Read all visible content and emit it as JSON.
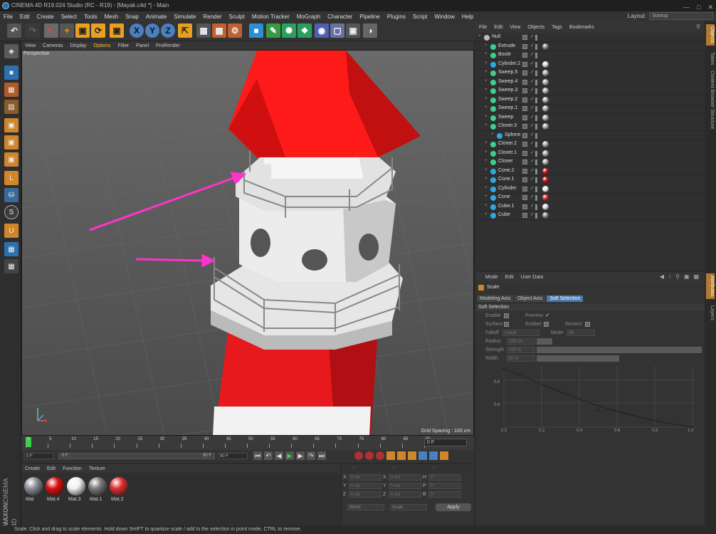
{
  "window": {
    "title": "CINEMA 4D R19.024 Studio (RC - R19) - [Mayak.c4d *] - Main"
  },
  "menu": [
    "File",
    "Edit",
    "Create",
    "Select",
    "Tools",
    "Mesh",
    "Snap",
    "Animate",
    "Simulate",
    "Render",
    "Sculpt",
    "Motion Tracker",
    "MoGraph",
    "Character",
    "Pipeline",
    "Plugins",
    "Script",
    "Window",
    "Help"
  ],
  "layout": {
    "label": "Layout:",
    "value": "Startup"
  },
  "viewport": {
    "menu": [
      "View",
      "Cameras",
      "Display",
      "Options",
      "Filter",
      "Panel",
      "ProRender"
    ],
    "camera": "Perspective",
    "grid_spacing": "Grid Spacing : 100 cm"
  },
  "timeline": {
    "ticks": [
      "0",
      "5",
      "10",
      "15",
      "20",
      "25",
      "30",
      "35",
      "40",
      "45",
      "50",
      "55",
      "60",
      "65",
      "70",
      "75",
      "80",
      "85",
      "90"
    ],
    "end_frame": "0 F"
  },
  "playback": {
    "start": "0 F",
    "cursor": "0 F",
    "range_end": "90 F",
    "end": "90 F"
  },
  "material_menu": [
    "Create",
    "Edit",
    "Function",
    "Texture"
  ],
  "materials": [
    {
      "name": "Mat",
      "color": "#8a8f96"
    },
    {
      "name": "Mat.4",
      "color": "#e01010"
    },
    {
      "name": "Mat.3",
      "color": "#f0f0f0"
    },
    {
      "name": "Mat.1",
      "color": "#7a7a7a"
    },
    {
      "name": "Mat.2",
      "color": "#e03030"
    }
  ],
  "coords": {
    "header": [
      "--",
      "--",
      "--"
    ],
    "rows": [
      {
        "a": "X",
        "v1": "0 cm",
        "b": "X",
        "v2": "0 cm",
        "c": "H",
        "v3": "0 °"
      },
      {
        "a": "Y",
        "v1": "0 cm",
        "b": "Y",
        "v2": "0 cm",
        "c": "P",
        "v3": "0 °"
      },
      {
        "a": "Z",
        "v1": "0 cm",
        "b": "Z",
        "v2": "0 cm",
        "c": "B",
        "v3": "0 °"
      }
    ],
    "mode1": "World",
    "mode2": "Scale",
    "apply": "Apply"
  },
  "object_menu": [
    "File",
    "Edit",
    "View",
    "Objects",
    "Tags",
    "Bookmarks"
  ],
  "objects": [
    {
      "name": "Null",
      "indent": 0,
      "icon": "#bbbbbb",
      "tag": ""
    },
    {
      "name": "Extrude",
      "indent": 1,
      "icon": "#3ccf8e",
      "tag": "#888"
    },
    {
      "name": "Boole",
      "indent": 1,
      "icon": "#3ccf8e",
      "tag": ""
    },
    {
      "name": "Cylinder.2",
      "indent": 1,
      "icon": "#2fa8e0",
      "tag": "#ddd"
    },
    {
      "name": "Sweep.5",
      "indent": 1,
      "icon": "#3ccf8e",
      "tag": "#aaa"
    },
    {
      "name": "Sweep.4",
      "indent": 1,
      "icon": "#3ccf8e",
      "tag": "#aaa"
    },
    {
      "name": "Sweep.3",
      "indent": 1,
      "icon": "#3ccf8e",
      "tag": "#aaa"
    },
    {
      "name": "Sweep.2",
      "indent": 1,
      "icon": "#3ccf8e",
      "tag": "#aaa"
    },
    {
      "name": "Sweep.1",
      "indent": 1,
      "icon": "#3ccf8e",
      "tag": "#aaa"
    },
    {
      "name": "Sweep",
      "indent": 1,
      "icon": "#3ccf8e",
      "tag": "#aaa"
    },
    {
      "name": "Cloner.3",
      "indent": 1,
      "icon": "#3ccf8e",
      "tag": "#aaa"
    },
    {
      "name": "Sphere",
      "indent": 2,
      "icon": "#2fa8e0",
      "tag": ""
    },
    {
      "name": "Cloner.2",
      "indent": 1,
      "icon": "#3ccf8e",
      "tag": "#aaa"
    },
    {
      "name": "Cloner.1",
      "indent": 1,
      "icon": "#3ccf8e",
      "tag": "#aaa"
    },
    {
      "name": "Cloner",
      "indent": 1,
      "icon": "#3ccf8e",
      "tag": "#aaa"
    },
    {
      "name": "Cone.2",
      "indent": 1,
      "icon": "#2fa8e0",
      "tag": "#e01010"
    },
    {
      "name": "Cone.1",
      "indent": 1,
      "icon": "#2fa8e0",
      "tag": "#e01010"
    },
    {
      "name": "Cylinder",
      "indent": 1,
      "icon": "#2fa8e0",
      "tag": "#eee"
    },
    {
      "name": "Cone",
      "indent": 1,
      "icon": "#2fa8e0",
      "tag": "#e03030"
    },
    {
      "name": "Cube.1",
      "indent": 1,
      "icon": "#2fa8e0",
      "tag": "#ddd"
    },
    {
      "name": "Cube",
      "indent": 1,
      "icon": "#2fa8e0",
      "tag": "#888"
    }
  ],
  "side_tabs": [
    "Objects",
    "Takes",
    "Content Browser",
    "Structure",
    "Attributes",
    "Layers"
  ],
  "attr_menu": [
    "Mode",
    "Edit",
    "User Data"
  ],
  "attr": {
    "title": "Scale",
    "tabs": [
      "Modeling Axis",
      "Object Axis",
      "Soft Selection"
    ],
    "section": "Soft Selection",
    "enable": "Enable",
    "preview": "Preview",
    "surface": "Surface",
    "rubber": "Rubber",
    "restrict": "Restrict",
    "falloff_label": "Falloff",
    "falloff": "Linear",
    "mode_label": "Mode",
    "mode": "All",
    "radius_label": "Radius",
    "radius": "100 cm",
    "strength_label": "Strength",
    "strength": "100 %",
    "width_label": "Width",
    "width": "50 %",
    "graph_y": [
      "0.8",
      "0.4"
    ],
    "graph_x": [
      "0.0",
      "0.2",
      "0.4",
      "0.6",
      "0.8",
      "1.0"
    ]
  },
  "status": "Scale: Click and drag to scale elements. Hold down SHIFT to quantize scale / add to the selection in point mode, CTRL to remove.",
  "brand": {
    "line1": "MAXON",
    "line2": "CINEMA 4D"
  }
}
